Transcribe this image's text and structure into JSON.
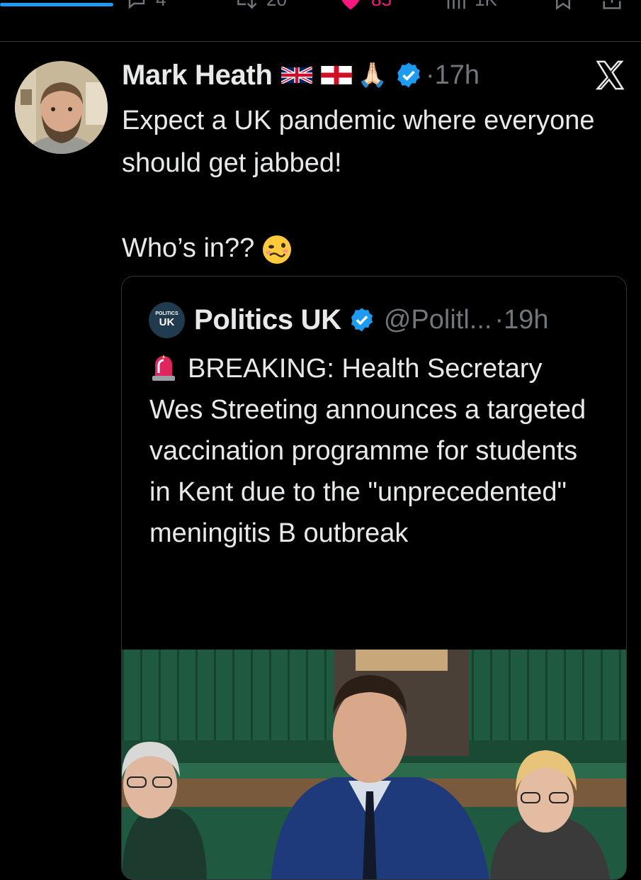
{
  "top_actions": [
    {
      "icon": "reply-icon",
      "count": "4"
    },
    {
      "icon": "retweet-icon",
      "count": "20"
    },
    {
      "icon": "like-icon",
      "count": "85"
    },
    {
      "icon": "views-icon",
      "count": "1K"
    },
    {
      "icon": "bookmark-icon",
      "count": ""
    },
    {
      "icon": "share-icon",
      "count": ""
    }
  ],
  "tweet": {
    "author_name": "Mark Heath",
    "emoji_pray": "🙏🏻",
    "separator": "·",
    "time": "17h",
    "text_line1": "Expect a UK pandemic where everyone should get jabbed!",
    "text_line2": "Who’s in??"
  },
  "quote": {
    "logo_line1": "POLITICS",
    "logo_line2": "UK",
    "name": "Politics UK",
    "handle": "@Politl...",
    "separator": "·",
    "time": "19h",
    "text": "BREAKING: Health Secretary Wes Streeting announces a targeted vaccination programme for students in Kent due to the \"unprecedented\" meningitis B outbreak"
  },
  "colors": {
    "background": "#000000",
    "text": "#e7e9ea",
    "secondary": "#71767b",
    "verified": "#1d9bf0",
    "like": "#f91880",
    "border": "#2f3336"
  }
}
